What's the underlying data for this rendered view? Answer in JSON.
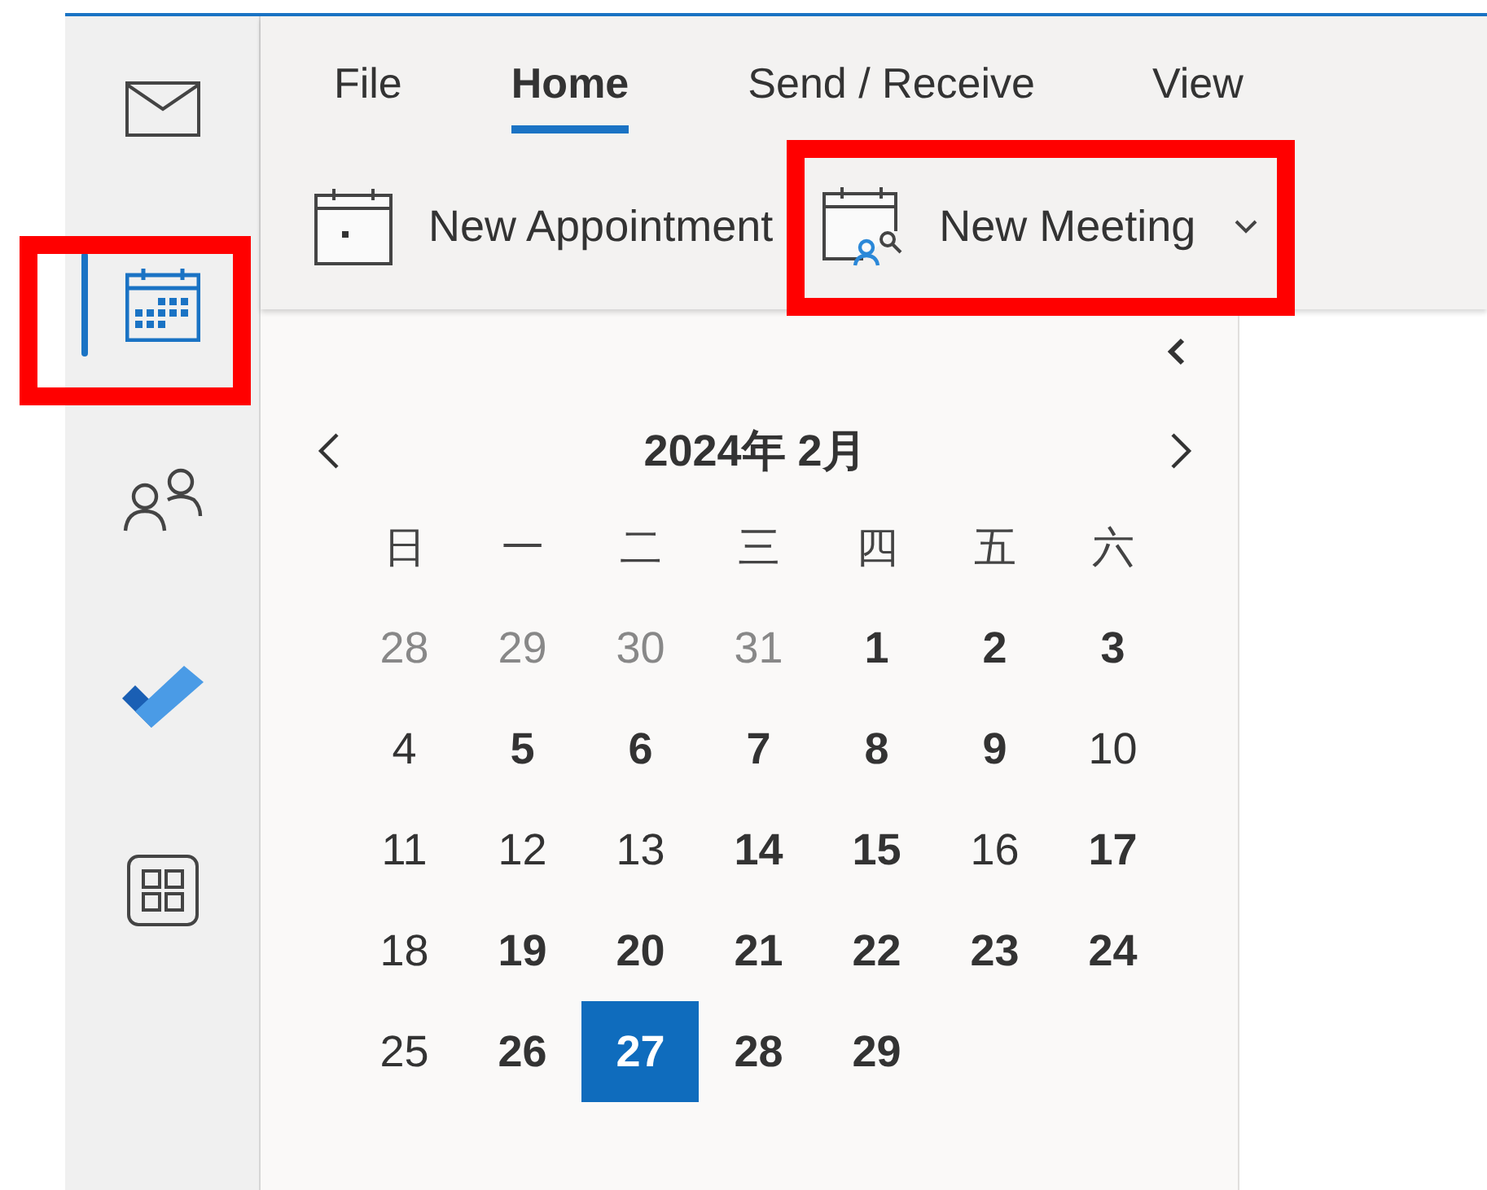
{
  "nav": [
    {
      "kind": "mail",
      "selected": false,
      "highlighted": false
    },
    {
      "kind": "calendar",
      "selected": true,
      "highlighted": true
    },
    {
      "kind": "people",
      "selected": false,
      "highlighted": false
    },
    {
      "kind": "todo",
      "selected": false,
      "highlighted": false
    },
    {
      "kind": "apps",
      "selected": false,
      "highlighted": false
    }
  ],
  "ribbon": {
    "tabs": [
      {
        "label": "File",
        "selected": false
      },
      {
        "label": "Home",
        "selected": true
      },
      {
        "label": "Send / Receive",
        "selected": false
      },
      {
        "label": "View",
        "selected": false
      }
    ],
    "commands": [
      {
        "kind": "appointment",
        "label": "New Appointment",
        "dropdown": false,
        "highlighted": false
      },
      {
        "kind": "meeting",
        "label": "New Meeting",
        "dropdown": true,
        "highlighted": true
      }
    ]
  },
  "calendar": {
    "title": "2024年 2月",
    "weekdays": [
      "日",
      "一",
      "二",
      "三",
      "四",
      "五",
      "六"
    ],
    "weeks": [
      [
        {
          "day": "28",
          "kind": "other",
          "selected": false
        },
        {
          "day": "29",
          "kind": "other",
          "selected": false
        },
        {
          "day": "30",
          "kind": "other",
          "selected": false
        },
        {
          "day": "31",
          "kind": "other",
          "selected": false
        },
        {
          "day": "1",
          "kind": "busy",
          "selected": false
        },
        {
          "day": "2",
          "kind": "busy",
          "selected": false
        },
        {
          "day": "3",
          "kind": "busy",
          "selected": false
        }
      ],
      [
        {
          "day": "4",
          "kind": "free",
          "selected": false
        },
        {
          "day": "5",
          "kind": "busy",
          "selected": false
        },
        {
          "day": "6",
          "kind": "busy",
          "selected": false
        },
        {
          "day": "7",
          "kind": "busy",
          "selected": false
        },
        {
          "day": "8",
          "kind": "busy",
          "selected": false
        },
        {
          "day": "9",
          "kind": "busy",
          "selected": false
        },
        {
          "day": "10",
          "kind": "free",
          "selected": false
        }
      ],
      [
        {
          "day": "11",
          "kind": "free",
          "selected": false
        },
        {
          "day": "12",
          "kind": "free",
          "selected": false
        },
        {
          "day": "13",
          "kind": "free",
          "selected": false
        },
        {
          "day": "14",
          "kind": "busy",
          "selected": false
        },
        {
          "day": "15",
          "kind": "busy",
          "selected": false
        },
        {
          "day": "16",
          "kind": "free",
          "selected": false
        },
        {
          "day": "17",
          "kind": "busy",
          "selected": false
        }
      ],
      [
        {
          "day": "18",
          "kind": "free",
          "selected": false
        },
        {
          "day": "19",
          "kind": "busy",
          "selected": false
        },
        {
          "day": "20",
          "kind": "busy",
          "selected": false
        },
        {
          "day": "21",
          "kind": "busy",
          "selected": false
        },
        {
          "day": "22",
          "kind": "busy",
          "selected": false
        },
        {
          "day": "23",
          "kind": "busy",
          "selected": false
        },
        {
          "day": "24",
          "kind": "busy",
          "selected": false
        }
      ],
      [
        {
          "day": "25",
          "kind": "free",
          "selected": false
        },
        {
          "day": "26",
          "kind": "busy",
          "selected": false
        },
        {
          "day": "27",
          "kind": "busy",
          "selected": true
        },
        {
          "day": "28",
          "kind": "busy",
          "selected": false
        },
        {
          "day": "29",
          "kind": "busy",
          "selected": false
        }
      ]
    ]
  }
}
